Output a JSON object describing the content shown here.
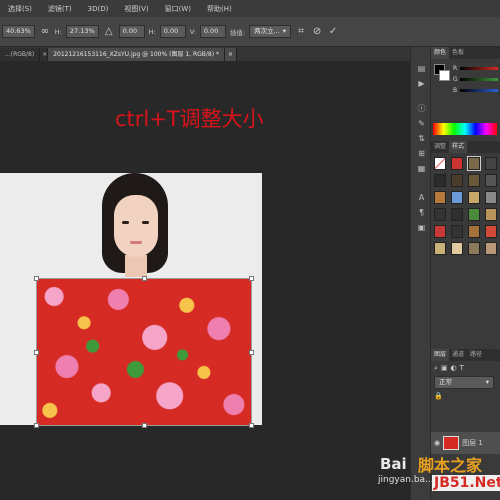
{
  "menubar": {
    "items": [
      "选择(S)",
      "滤镜(T)",
      "3D(D)",
      "视图(V)",
      "窗口(W)",
      "帮助(H)"
    ]
  },
  "options_bar": {
    "zoom_value": "40.63%",
    "h_label": "H:",
    "h_value": "27.13%",
    "angle_value": "0.00",
    "hskew_label": "H:",
    "hskew_value": "0.00",
    "vskew_label": "V:",
    "vskew_value": "0.00",
    "interp_label": "插值:",
    "interp_value": "两次立..."
  },
  "tabs": [
    {
      "label": "...(RGB/8)",
      "active": false
    },
    {
      "label": "20121216153116_XZsYU.jpg @ 100% (图层 1, RGB/8) *",
      "active": true
    }
  ],
  "canvas": {
    "overlay_text": "ctrl+T调整大小"
  },
  "panels": {
    "color_tabs": [
      "颜色",
      "色板"
    ],
    "sliders": [
      {
        "label": "R",
        "color": "#d62a24"
      },
      {
        "label": "G",
        "color": "#3f9a3a"
      },
      {
        "label": "B",
        "color": "#2d5fd8"
      }
    ],
    "style_tabs": [
      "调整",
      "样式"
    ],
    "layer_tabs": [
      "图层",
      "通道",
      "路径"
    ],
    "blend_mode": "正常",
    "layer_name": "图层 1"
  },
  "watermarks": {
    "baidu": "Bai",
    "jingyan": "jingyan.ba...",
    "site": "脚本之家",
    "jb51": "JB51.Net"
  },
  "colors": {
    "overlay_text": "#d8141a",
    "ps_bg": "#282828",
    "fabric_red": "#d62a24"
  }
}
